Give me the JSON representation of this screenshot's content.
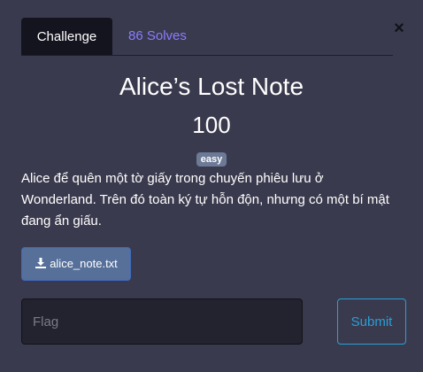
{
  "tabs": {
    "challenge_label": "Challenge",
    "solves_label": "86 Solves"
  },
  "close": {
    "glyph": "×",
    "icon": "close-icon"
  },
  "challenge": {
    "title": "Alice’s Lost Note",
    "points": "100",
    "difficulty": "easy",
    "description": "Alice để quên một tờ giấy trong chuyến phiêu lưu ở Wonderland. Trên đó toàn ký tự hỗn độn, nhưng có một bí mật đang ẩn giấu."
  },
  "attachment": {
    "filename": "alice_note.txt",
    "icon": "download-icon"
  },
  "flag_form": {
    "placeholder": "Flag",
    "value": "",
    "submit_label": "Submit"
  },
  "colors": {
    "background": "#3a3a4e",
    "accent_purple": "#8a7cff",
    "accent_blue": "#2a9fd6",
    "badge": "#6c7a96",
    "download_button": "#56709a"
  }
}
